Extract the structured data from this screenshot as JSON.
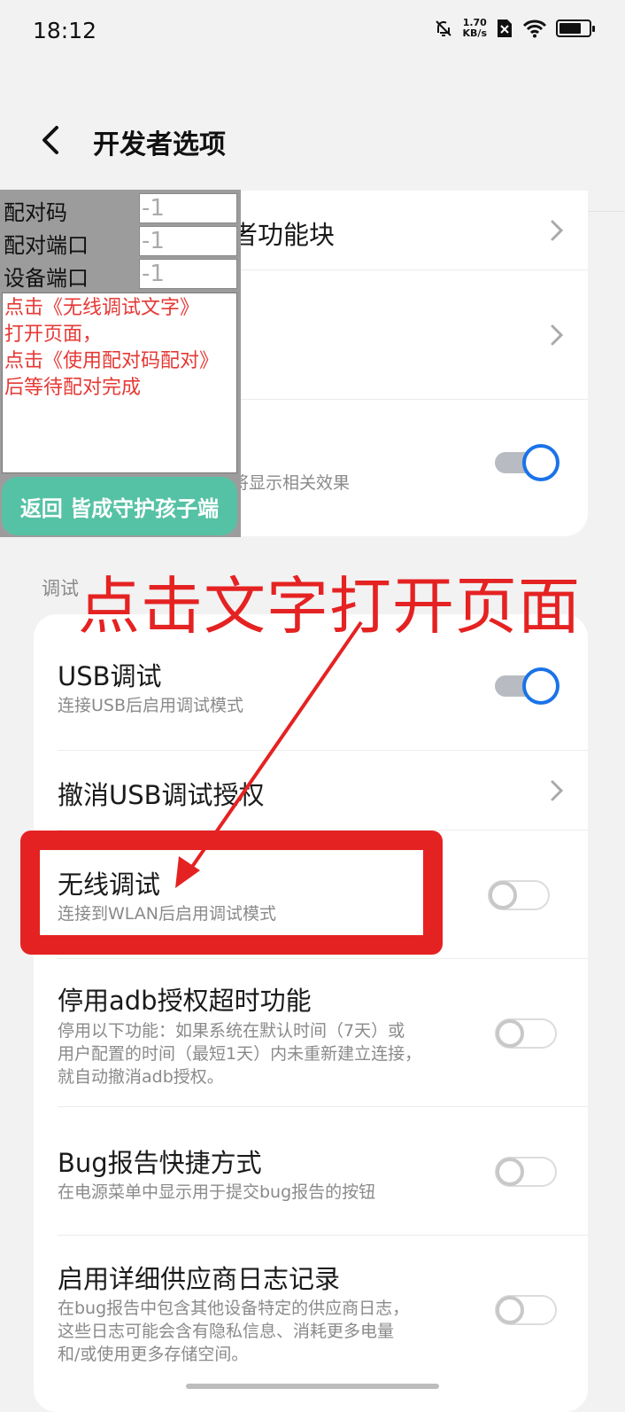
{
  "status_bar": {
    "time": "18:12",
    "net_speed_value": "1.70",
    "net_speed_unit": "KB/s",
    "icons": [
      "bell-off-icon",
      "sim-off-icon",
      "wifi-icon",
      "battery-icon"
    ],
    "battery_level": 0.75
  },
  "header": {
    "title": "开发者选项"
  },
  "top_card": {
    "partial_row_title": "者功能块",
    "row3_sub": "将显示相关效果",
    "row3_toggle_on": true
  },
  "section_label": "调试",
  "debug_rows": [
    {
      "title": "USB调试",
      "sub": "连接USB后启用调试模式",
      "toggle": true
    },
    {
      "title": "撤消USB调试授权",
      "sub": ""
    },
    {
      "title": "无线调试",
      "sub": "连接到WLAN后启用调试模式",
      "toggle": false
    },
    {
      "title": "停用adb授权超时功能",
      "sub_lines": [
        "停用以下功能：如果系统在默认时间（7天）或",
        "用户配置的时间（最短1天）内未重新建立连接，",
        "就自动撤消adb授权。"
      ],
      "toggle": false
    },
    {
      "title": "Bug报告快捷方式",
      "sub": "在电源菜单中显示用于提交bug报告的按钮",
      "toggle": false
    },
    {
      "title": "启用详细供应商日志记录",
      "sub_lines": [
        "在bug报告中包含其他设备特定的供应商日志，",
        "这些日志可能会含有隐私信息、消耗更多电量",
        "和/或使用更多存储空间。"
      ],
      "toggle": false
    }
  ],
  "overlay": {
    "pair_code_label": "配对码",
    "pair_port_label": "配对端口",
    "device_port_label": "设备端口",
    "pair_code_value": "-1",
    "pair_port_value": "-1",
    "device_port_value": "-1",
    "note_lines": [
      "点击《无线调试文字》",
      "打开页面，",
      "点击《使用配对码配对》",
      "后等待配对完成"
    ],
    "return_button": "返回 皆成守护孩子端"
  },
  "annotation": {
    "text": "点击文字打开页面",
    "color": "#e52222"
  },
  "colors": {
    "accent": "#1a73e8",
    "overlay_button": "#56c2a5",
    "note_text": "#e53935"
  }
}
